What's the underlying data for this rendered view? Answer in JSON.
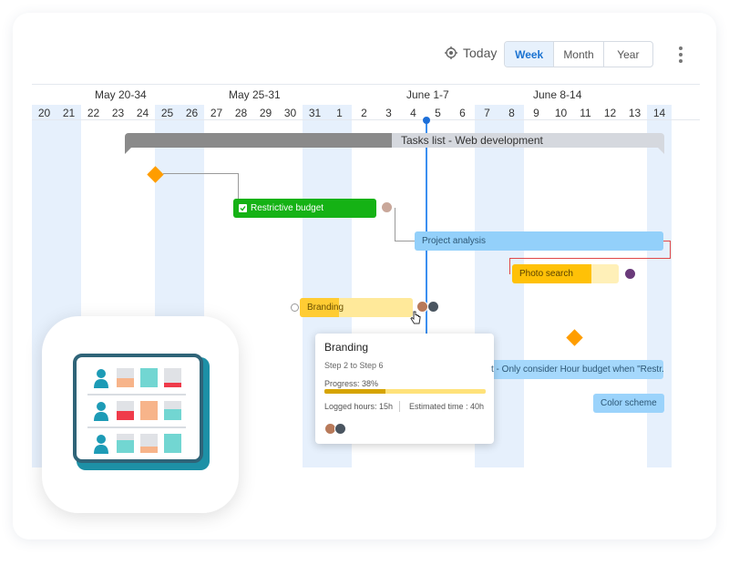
{
  "toolbar": {
    "today_label": "Today",
    "view_options": [
      "Week",
      "Month",
      "Year"
    ],
    "active_view": "Week"
  },
  "timeline": {
    "weeks": [
      "May 20-34",
      "May 25-31",
      "June 1-7",
      "June 8-14"
    ],
    "days": [
      "20",
      "21",
      "22",
      "23",
      "24",
      "25",
      "26",
      "27",
      "28",
      "29",
      "30",
      "31",
      "1",
      "2",
      "3",
      "4",
      "5",
      "6",
      "7",
      "8",
      "9",
      "10",
      "11",
      "12",
      "13",
      "14"
    ],
    "today_day": "4"
  },
  "group": {
    "label": "Tasks list - Web development"
  },
  "tasks": {
    "restrictive_budget": "Restrictive budget",
    "project_analysis": "Project analysis",
    "photo_search": "Photo search",
    "branding": "Branding",
    "hour_budget": "t - Only consider Hour budget when \"Restr...",
    "color_scheme": "Color scheme"
  },
  "progress": {
    "photo_search": 0.74,
    "branding": 0.35
  },
  "tooltip": {
    "title": "Branding",
    "steps": "Step 2 to Step 6",
    "progress_label": "Progress: 38%",
    "progress": 0.38,
    "logged": "Logged hours: 15h",
    "estimated": "Estimated time : 40h"
  },
  "colors": {
    "accent": "#1b73d1",
    "milestone": "#ff9d00",
    "done": "#15b215",
    "in_progress": "#ffc107",
    "planned": "#93d0fa",
    "weekend_shade": "#e6f0fc",
    "app_icon_teal": "#1d90a6"
  },
  "icons": [
    "target-icon",
    "kebab-menu-icon",
    "checkbox-icon",
    "avatar-icon",
    "hand-cursor-icon",
    "milestone-diamond-icon",
    "person-icon",
    "spreadsheet-app-icon"
  ]
}
